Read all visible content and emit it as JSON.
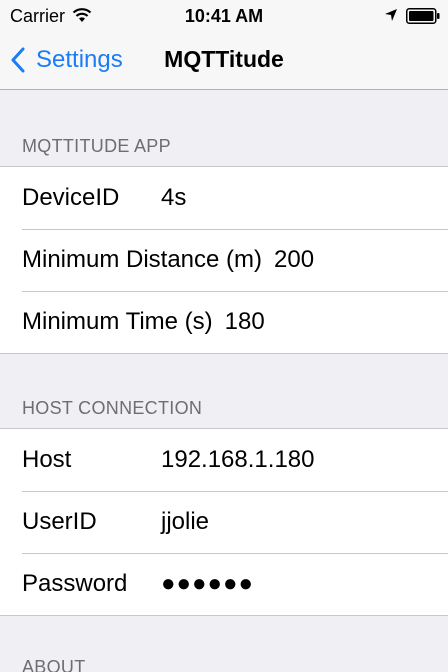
{
  "status_bar": {
    "carrier": "Carrier",
    "time": "10:41 AM",
    "icons": [
      "wifi-icon",
      "location-icon",
      "battery-icon"
    ]
  },
  "nav": {
    "back_label": "Settings",
    "title": "MQTTitude",
    "accent_color": "#1a7cf7"
  },
  "sections": {
    "app": {
      "header": "MQTTITUDE APP",
      "rows": {
        "device_id": {
          "label": "DeviceID",
          "value": "4s"
        },
        "min_distance": {
          "label": "Minimum Distance (m)",
          "value": "200"
        },
        "min_time": {
          "label": "Minimum Time (s)",
          "value": "180"
        }
      }
    },
    "host": {
      "header": "HOST CONNECTION",
      "rows": {
        "host": {
          "label": "Host",
          "value": "192.168.1.180"
        },
        "user_id": {
          "label": "UserID",
          "value": "jjolie"
        },
        "password": {
          "label": "Password",
          "value": "●●●●●●"
        }
      }
    },
    "about": {
      "header": "ABOUT"
    }
  }
}
